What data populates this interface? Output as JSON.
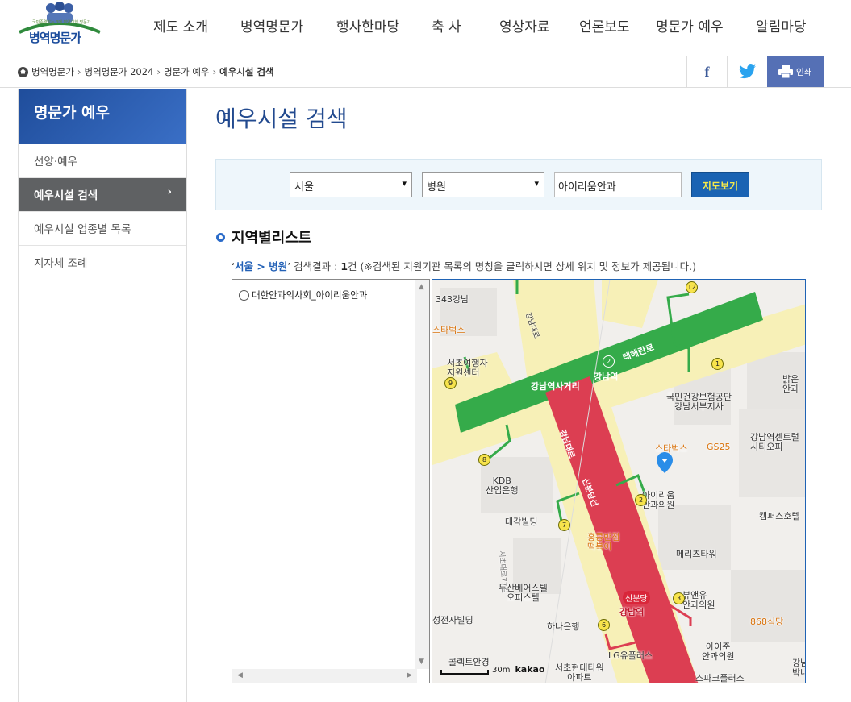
{
  "header": {
    "logo_text": "병역명문가",
    "logo_subtext": "국민존경받는 3대 병역이행 명문가",
    "nav": [
      "제도 소개",
      "병역명문가",
      "행사한마당",
      "축 사",
      "영상자료",
      "언론보도",
      "명문가 예우",
      "알림마당"
    ]
  },
  "breadcrumb": [
    "병역명문가",
    "병역명문가 2024",
    "명문가 예우",
    "예우시설 검색"
  ],
  "share": {
    "facebook": "f",
    "print_label": "인쇄"
  },
  "sidebar": {
    "title": "명문가 예우",
    "items": [
      {
        "label": "선양·예우"
      },
      {
        "label": "예우시설 검색",
        "active": true,
        "arrow": "›"
      },
      {
        "label": "예우시설 업종별 목록"
      },
      {
        "label": "지자체 조례"
      }
    ]
  },
  "page_title": "예우시설 검색",
  "search": {
    "region": "서울",
    "category": "병원",
    "keyword": "아이리움안과",
    "button_label": "지도보기"
  },
  "section_title": "지역별리스트",
  "result": {
    "quote_open": "‘",
    "region": "서울",
    "arrow": " > ",
    "category": "병원",
    "quote_close": "’",
    "text1": " 검색결과 : ",
    "count": "1",
    "unit": "건",
    "note": " (※검색된 지원기관 목록의 명칭을 클릭하시면 상세 위치 및 정보가 제공됩니다.)"
  },
  "list": [
    {
      "label": "대한안과의사회_아이리움안과"
    }
  ],
  "map": {
    "labels": {
      "l1": "343강남",
      "l2": "스타벅스",
      "l3": "서초여행자\n지원센터",
      "l4": "강남역사거리",
      "l5": "강남역",
      "l6": "테헤란로",
      "l7": "국민건강보험공단\n강남서부지사",
      "l8": "밝은\n안과",
      "l9": "강남역센트럴\n시티오피",
      "l10": "스타벅스",
      "l11": "GS25",
      "l12": "KDB\n산업은행",
      "l13": "대각빌딩",
      "l14": "아이리움\n안과의원",
      "l15": "캠퍼스호텔",
      "l16": "홍콩반점\n떡볶이",
      "l17": "메리츠타워",
      "l18": "두산베어스텔\n오피스텔",
      "l19": "신분당",
      "l20": "강남역",
      "l21": "뷰앤유\n안과의원",
      "l22": "성전자빌딩",
      "l23": "하나은행",
      "l24": "868식당",
      "l25": "콜렉트안경",
      "l26": "서초현대타워\n아파트",
      "l27": "LG유플러스",
      "l28": "아이준\n안과의원",
      "l29": "강남\n박내과",
      "l30": "스파크플러스",
      "l31": "강남대로",
      "l32": "신분당선",
      "l33": "강남대로",
      "l34": "서초대로77길"
    },
    "exits": [
      "12",
      "1",
      "2",
      "9",
      "8",
      "7",
      "3",
      "6",
      "2"
    ],
    "scale_label": "30m",
    "brand": "kakao"
  }
}
